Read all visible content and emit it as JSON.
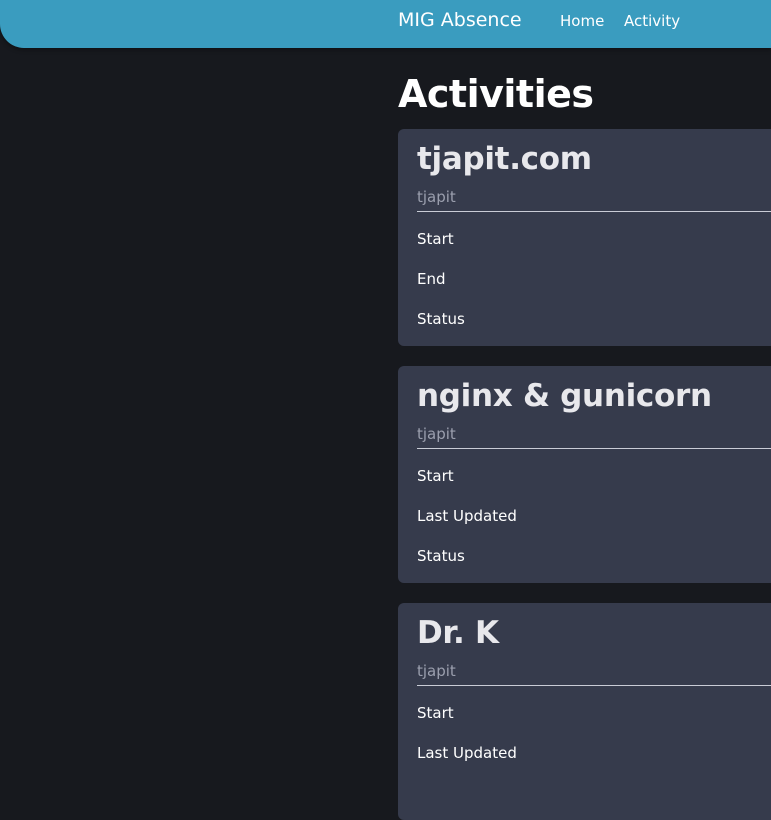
{
  "navbar": {
    "brand": "MIG Absence",
    "links": [
      {
        "label": "Home"
      },
      {
        "label": "Activity"
      }
    ]
  },
  "main": {
    "title": "Activities",
    "cards": [
      {
        "title": "tjapit.com",
        "owner": "tjapit",
        "fields": [
          "Start",
          "End",
          "Status"
        ]
      },
      {
        "title": "nginx & gunicorn",
        "owner": "tjapit",
        "fields": [
          "Start",
          "Last Updated",
          "Status"
        ]
      },
      {
        "title": "Dr. K",
        "owner": "tjapit",
        "fields": [
          "Start",
          "Last Updated"
        ]
      }
    ]
  }
}
